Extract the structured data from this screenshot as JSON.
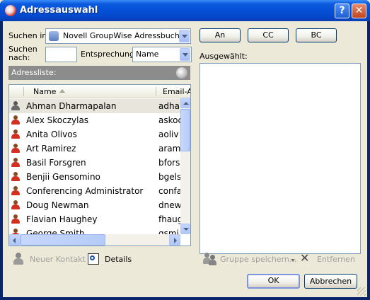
{
  "window": {
    "title": "Adressauswahl",
    "help_label": "?",
    "close_label": "✕"
  },
  "search": {
    "in_label": "Suchen in:",
    "addressbook_value": "Novell GroupWise Adressbuch",
    "for_label": "Suchen nach:",
    "for_value": "",
    "match_label": "Entsprechung:",
    "match_value": "Name"
  },
  "address_list": {
    "title": "Adressliste:",
    "columns": [
      "Name",
      "Email-Ad"
    ],
    "rows": [
      {
        "name": "Ahman Dharmapalan",
        "email": "adha",
        "selected": true,
        "icon": "user-gray-icon"
      },
      {
        "name": "Alex Skoczylas",
        "email": "askoc",
        "icon": "user-icon"
      },
      {
        "name": "Anita Olivos",
        "email": "aoliv",
        "icon": "user-icon"
      },
      {
        "name": "Art Ramirez",
        "email": "aram",
        "icon": "user-icon"
      },
      {
        "name": "Basil Forsgren",
        "email": "bfors",
        "icon": "user-icon"
      },
      {
        "name": "Benjii Gensomino",
        "email": "bgels",
        "icon": "user-icon"
      },
      {
        "name": "Conferencing Administrator",
        "email": "confa",
        "icon": "user-icon"
      },
      {
        "name": "Doug Newman",
        "email": "dnew",
        "icon": "user-icon"
      },
      {
        "name": "Flavian Haughey",
        "email": "fhaug",
        "icon": "user-icon"
      },
      {
        "name": "George Smith",
        "email": "gsmi",
        "icon": "user-icon"
      }
    ]
  },
  "buttons": {
    "to": "An",
    "cc": "CC",
    "bc": "BC",
    "ok": "OK",
    "cancel": "Abbrechen"
  },
  "selected_label": "Ausgewählt:",
  "actions": {
    "new_contact": "Neuer Kontakt",
    "details": "Details",
    "save_group": "Gruppe speichern...",
    "remove": "Entfernen"
  },
  "colors": {
    "title_bar": "#0551D8",
    "header_bar": "#8C8C8C",
    "selected_row": "#E8E6DC"
  }
}
